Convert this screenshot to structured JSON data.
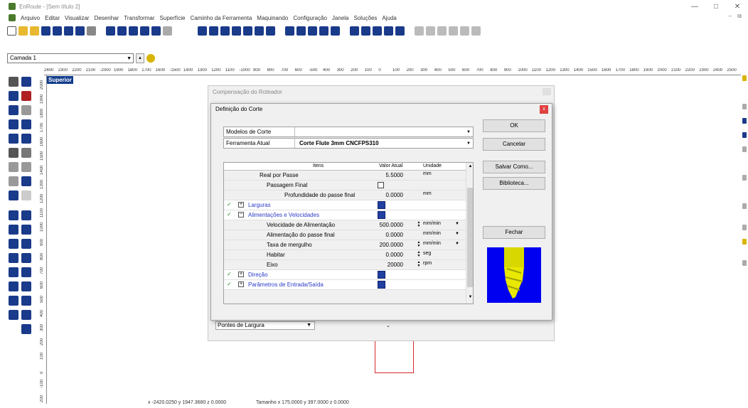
{
  "window": {
    "title": "EnRoute - [Sem título 2]",
    "controls": [
      "—",
      "□",
      "✕"
    ]
  },
  "menu": {
    "items": [
      "Arquivo",
      "Editar",
      "Visualizar",
      "Desenhar",
      "Transformar",
      "Superfície",
      "Caminho da Ferramenta",
      "Maquinando",
      "Configuração",
      "Janela",
      "Soluções",
      "Ajuda"
    ],
    "mdi_controls": "– ⧉"
  },
  "layer": {
    "value": "Camada 1"
  },
  "view": {
    "label": "Superior"
  },
  "rulers": {
    "horizontal": [
      "2400",
      "2300",
      "2200",
      "2100",
      "-2000",
      "1900",
      "1800",
      "1700",
      "1600",
      "-1500",
      "1400",
      "1300",
      "1200",
      "1100",
      "-1000",
      "900",
      "800",
      "700",
      "600",
      "-500",
      "400",
      "300",
      "200",
      "100",
      "0",
      "100",
      "200",
      "300",
      "400",
      "500",
      "600",
      "700",
      "800",
      "900",
      "1000",
      "1100",
      "1200",
      "1300",
      "1400",
      "1500",
      "1600",
      "1700",
      "1800",
      "1900",
      "2000",
      "2100",
      "2200",
      "2300",
      "2400",
      "2500"
    ],
    "vertical": [
      "2000",
      "1900",
      "1800",
      "1700",
      "1600",
      "1500",
      "1400",
      "1300",
      "1200",
      "1100",
      "1000",
      "900",
      "800",
      "700",
      "600",
      "500",
      "400",
      "300",
      "200",
      "100",
      "0",
      "-100",
      "200"
    ]
  },
  "status": {
    "coords": "x -2420.0250 y 1947.3680 z 0.0000",
    "size": "Tamanho x 175.0000 y 397.0000 z 0.0000"
  },
  "bg_dialog": {
    "title": "Compensação do Roteador",
    "pontes_label": "Pontes de Largura"
  },
  "dialog": {
    "title": "Definição do Corte",
    "close": "x",
    "modelos_label": "Modelos de Corte",
    "modelos_value": "",
    "ferramenta_label": "Ferramenta Atual",
    "ferramenta_value": "Corte Flute 3mm CNCFPS310",
    "buttons": {
      "ok": "OK",
      "cancelar": "Cancelar",
      "salvar": "Salvar Como...",
      "biblioteca": "Biblioteca...",
      "fechar": "Fechar"
    },
    "grid": {
      "headers": {
        "itens": "Itens",
        "valor": "Valor Atual",
        "unidade": "Unidade"
      },
      "rows": [
        {
          "label": "Real por Passe",
          "value": "5.5000",
          "unit": "mm"
        },
        {
          "label": "Passagem Final",
          "value": "",
          "unit": ""
        },
        {
          "label": "Profundidade do passe final",
          "value": "0.0000",
          "unit": "mm"
        },
        {
          "label": "Larguras",
          "value": "",
          "unit": ""
        },
        {
          "label": "Alimentações e Velocidades",
          "value": "",
          "unit": ""
        },
        {
          "label": "Velocidade de Alimentação",
          "value": "500.0000",
          "unit": "mm/min"
        },
        {
          "label": "Alimentação do passe final",
          "value": "0.0000",
          "unit": "mm/min"
        },
        {
          "label": "Taxa de mergulho",
          "value": "200.0000",
          "unit": "mm/min"
        },
        {
          "label": "Habitar",
          "value": "0.0000",
          "unit": "seg"
        },
        {
          "label": "Eixo",
          "value": "20000",
          "unit": "rpm"
        },
        {
          "label": "Direção",
          "value": "",
          "unit": ""
        },
        {
          "label": "Parâmetros de Entrada/Saída",
          "value": "",
          "unit": ""
        }
      ]
    }
  }
}
